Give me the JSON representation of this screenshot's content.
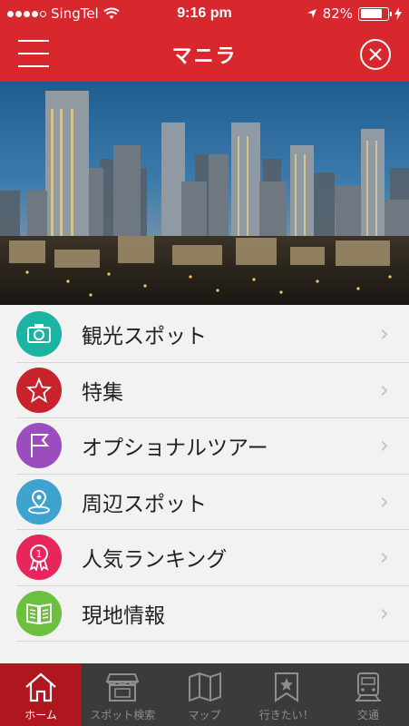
{
  "status_bar": {
    "carrier": "SingTel",
    "time": "9:16 pm",
    "battery": "82%",
    "battery_level": 0.82
  },
  "nav": {
    "title": "マニラ",
    "menu_icon": "hamburger-menu-icon",
    "close_icon": "close-icon"
  },
  "hero": {
    "image": "manila-city-skyline-photo"
  },
  "menu": {
    "items": [
      {
        "label": "観光スポット",
        "icon": "camera-icon",
        "color": "#1bb3a2"
      },
      {
        "label": "特集",
        "icon": "star-icon",
        "color": "#c8232b"
      },
      {
        "label": "オプショナルツアー",
        "icon": "flag-icon",
        "color": "#9b4dbf"
      },
      {
        "label": "周辺スポット",
        "icon": "location-pin-icon",
        "color": "#3fa3cf"
      },
      {
        "label": "人気ランキング",
        "icon": "ranking-medal-icon",
        "color": "#e8265c"
      },
      {
        "label": "現地情報",
        "icon": "book-icon",
        "color": "#6cbf3f"
      }
    ]
  },
  "tabbar": {
    "tabs": [
      {
        "label": "ホーム",
        "icon": "home-icon",
        "active": true
      },
      {
        "label": "スポット検索",
        "icon": "shop-icon",
        "active": false
      },
      {
        "label": "マップ",
        "icon": "map-icon",
        "active": false
      },
      {
        "label": "行きたい！",
        "icon": "bookmark-star-icon",
        "active": false
      },
      {
        "label": "交通",
        "icon": "train-icon",
        "active": false
      }
    ]
  },
  "colors": {
    "brand_red": "#d9272e",
    "tab_active": "#b0161d",
    "tab_bg": "#3b3b3b"
  }
}
